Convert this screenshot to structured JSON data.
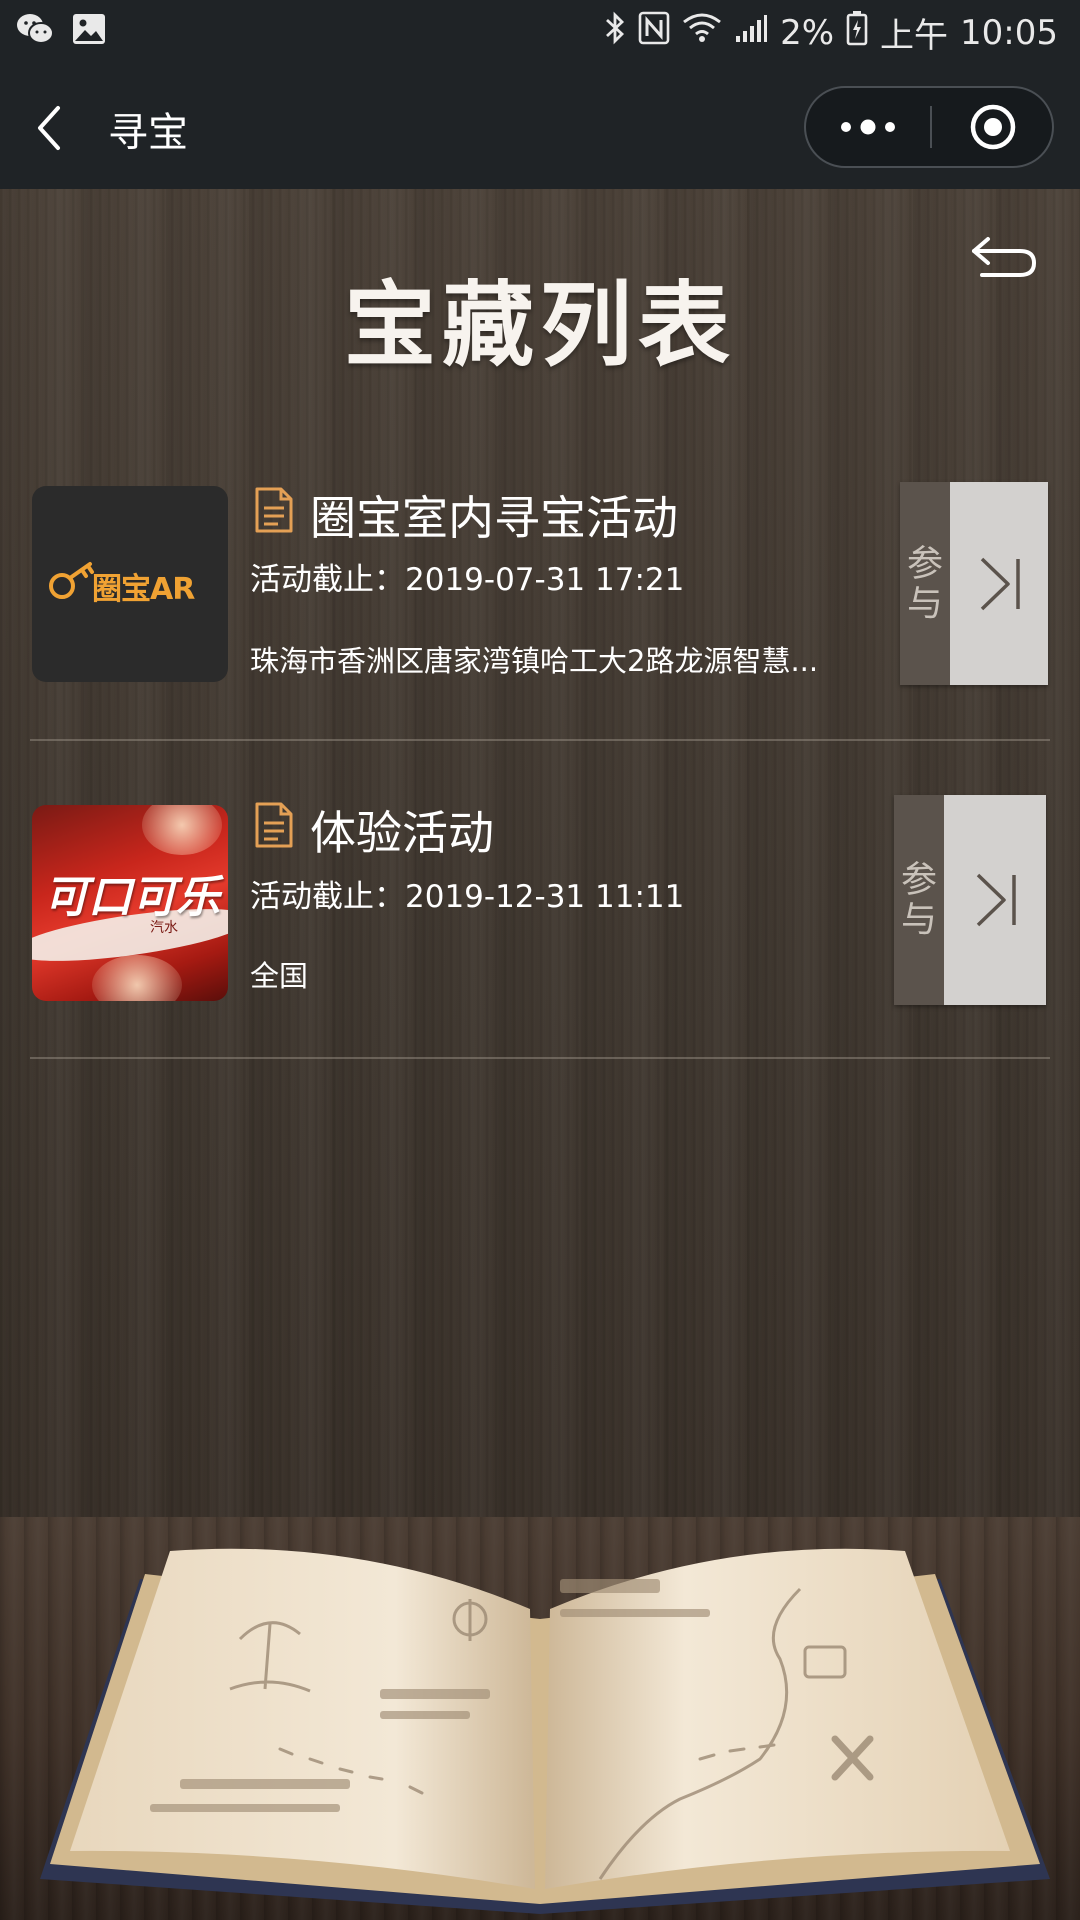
{
  "status_bar": {
    "percent": "2%",
    "period": "上午",
    "time": "10:05",
    "left_icons": [
      "wechat-icon",
      "image-icon"
    ],
    "right_icons": [
      "bluetooth-icon",
      "nfc-icon",
      "wifi-icon",
      "signal-icon",
      "battery-icon"
    ]
  },
  "nav": {
    "title": "寻宝"
  },
  "page": {
    "heading": "宝藏列表"
  },
  "items": [
    {
      "title": "圈宝室内寻宝活动",
      "deadline": "活动截止：2019-07-31 17:21",
      "address": "珠海市香洲区唐家湾镇哈工大2路龙源智慧...",
      "thumb_text": "圈宝AR",
      "join_label": "参与"
    },
    {
      "title": "体验活动",
      "deadline": "活动截止：2019-12-31 11:11",
      "address": "全国",
      "thumb_text": "可口可乐",
      "thumb_sub": "汽水",
      "join_label": "参与"
    }
  ],
  "colors": {
    "bar_bg": "#1f2326",
    "accent_orange": "#f0a233",
    "wood": "#3f372f",
    "join_button": "#d3d1cf"
  }
}
